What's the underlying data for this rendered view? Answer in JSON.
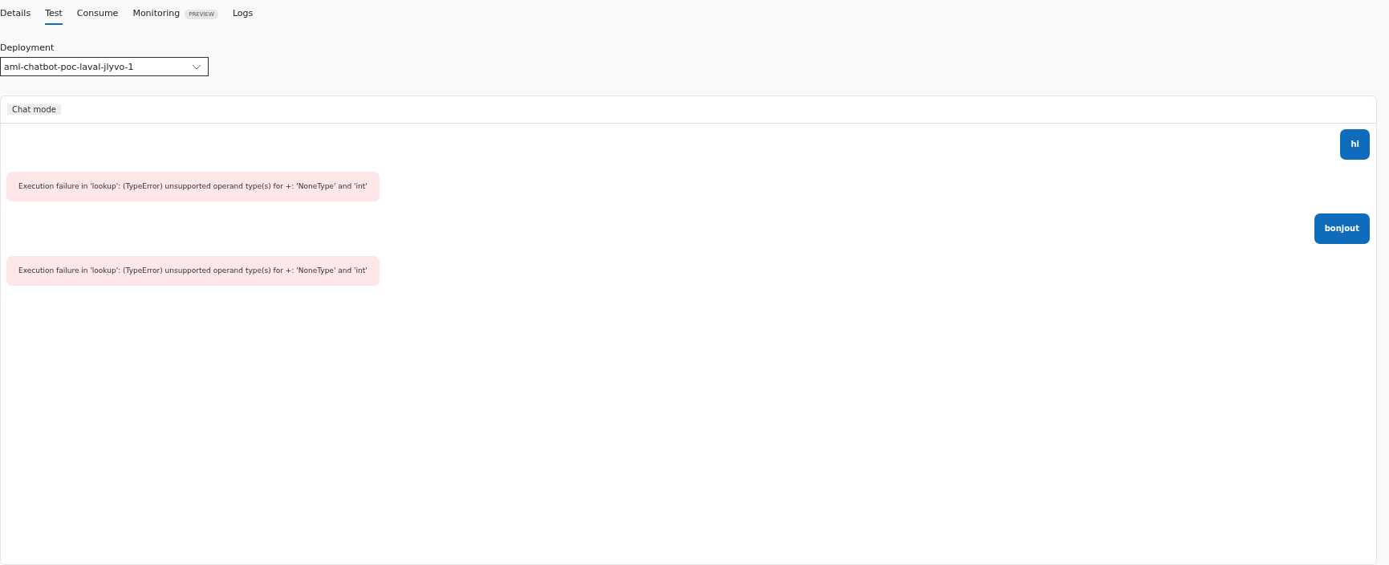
{
  "tabs": [
    {
      "label": "Details",
      "selected": false
    },
    {
      "label": "Test",
      "selected": true
    },
    {
      "label": "Consume",
      "selected": false
    },
    {
      "label": "Monitoring",
      "badge": "PREVIEW",
      "selected": false
    },
    {
      "label": "Logs",
      "selected": false
    }
  ],
  "deployment": {
    "label": "Deployment",
    "value": "aml-chatbot-poc-laval-jlyvo-1"
  },
  "chat": {
    "mode_label": "Chat mode",
    "messages": [
      {
        "kind": "user",
        "text": "hi"
      },
      {
        "kind": "error",
        "text": "Execution failure in 'lookup': (TypeError) unsupported operand type(s) for +: 'NoneType' and 'int'"
      },
      {
        "kind": "user",
        "text": "bonjout"
      },
      {
        "kind": "error",
        "text": "Execution failure in 'lookup': (TypeError) unsupported operand type(s) for +: 'NoneType' and 'int'"
      }
    ]
  }
}
